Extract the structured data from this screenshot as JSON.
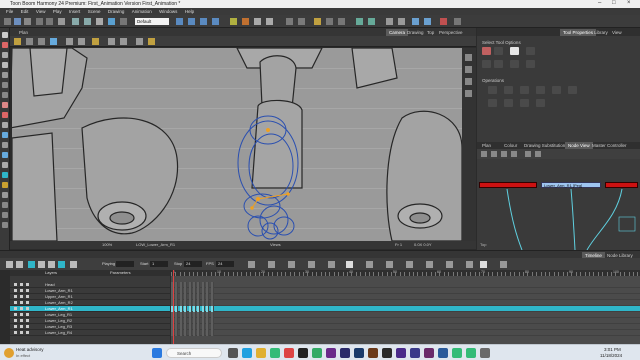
{
  "window": {
    "title": "Toon Boom Harmony 24 Premium: First_Animation Version First_Animation *"
  },
  "menu": [
    "File",
    "Edit",
    "View",
    "Play",
    "Insert",
    "Scene",
    "Drawing",
    "Animation",
    "Windows",
    "Help"
  ],
  "toolbar": {
    "workspace": "Default"
  },
  "view_tabs": {
    "left_label": "Plan",
    "camera": "Camera",
    "drawing": "Drawing",
    "top": "Top",
    "perspective": "Perspective"
  },
  "view_status": {
    "zoom": "100%",
    "drawing_name": "LOW_Lower_Arm_R1",
    "status_field": "Views",
    "frame": "Fr 1",
    "coords": "0.0X 0.0Y"
  },
  "right_panel": {
    "tabs": [
      "Tool Properties",
      "Library",
      "View"
    ],
    "select_title": "Select Tool Options",
    "operations_title": "Operations",
    "node_tabs": [
      "Plan",
      "Colour",
      "Drawing Substitutions",
      "Node View",
      "Master Controller"
    ],
    "node_label": "Lower_Arm_R1 [Peg]",
    "footer": "Top"
  },
  "timeline": {
    "tab_timeline": "Timeline",
    "tab_node_library": "Node Library",
    "playing_label": "Playing",
    "start_label": "Start",
    "start_value": "1",
    "stop_label": "Stop",
    "stop_value": "24",
    "fps_label": "FPS",
    "fps_value": "24",
    "layers_header": "Layers",
    "param_header": "Parameters",
    "layers": [
      {
        "name": "Head"
      },
      {
        "name": "Lower_Arm_R1"
      },
      {
        "name": "Upper_Arm_R1"
      },
      {
        "name": "Lower_Arm_R2"
      },
      {
        "name": "Lower_Arm_R1"
      },
      {
        "name": "Lower_Leg_R1"
      },
      {
        "name": "Lower_Leg_R2"
      },
      {
        "name": "Lower_Leg_R3"
      },
      {
        "name": "Lower_Leg_R4"
      }
    ],
    "ruler_labels": [
      "1",
      "10",
      "20",
      "30",
      "40",
      "50",
      "60",
      "70",
      "80",
      "90",
      "100"
    ]
  },
  "taskbar": {
    "notice_title": "Heat advisory",
    "notice_sub": "In effect",
    "search_placeholder": "Search",
    "time": "3:01 PM",
    "date": "11/18/2024"
  },
  "colors": {
    "accent_cyan": "#2fb6c9",
    "node_red": "#cc1111",
    "viewport_gray": "#9a9a9a",
    "outline_blue": "#2a4fb0",
    "pivot_orange": "#f0a020"
  }
}
